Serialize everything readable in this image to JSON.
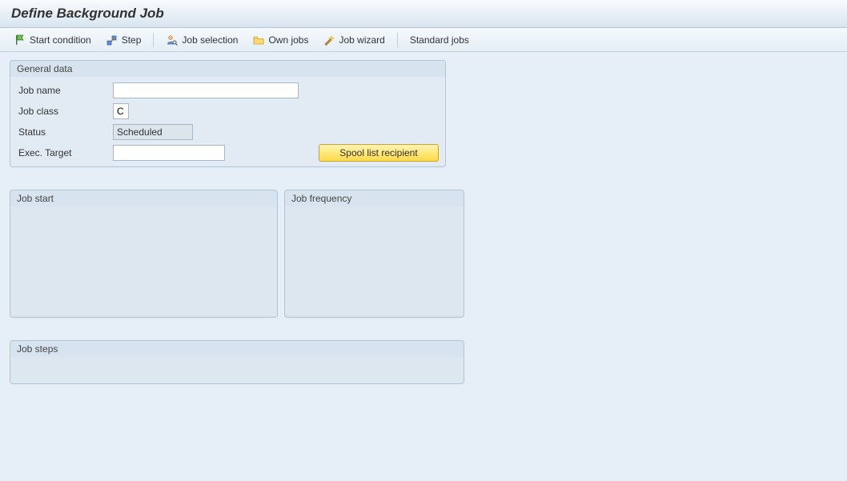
{
  "title": "Define Background Job",
  "toolbar": {
    "start_condition": "Start condition",
    "step": "Step",
    "job_selection": "Job selection",
    "own_jobs": "Own jobs",
    "job_wizard": "Job wizard",
    "standard_jobs": "Standard jobs"
  },
  "groups": {
    "general_data": "General data",
    "job_start": "Job start",
    "job_frequency": "Job frequency",
    "job_steps": "Job steps"
  },
  "form": {
    "job_name_label": "Job name",
    "job_name_value": "",
    "job_class_label": "Job class",
    "job_class_value": "C",
    "status_label": "Status",
    "status_value": "Scheduled",
    "exec_target_label": "Exec. Target",
    "exec_target_value": "",
    "spool_button": "Spool list recipient"
  }
}
